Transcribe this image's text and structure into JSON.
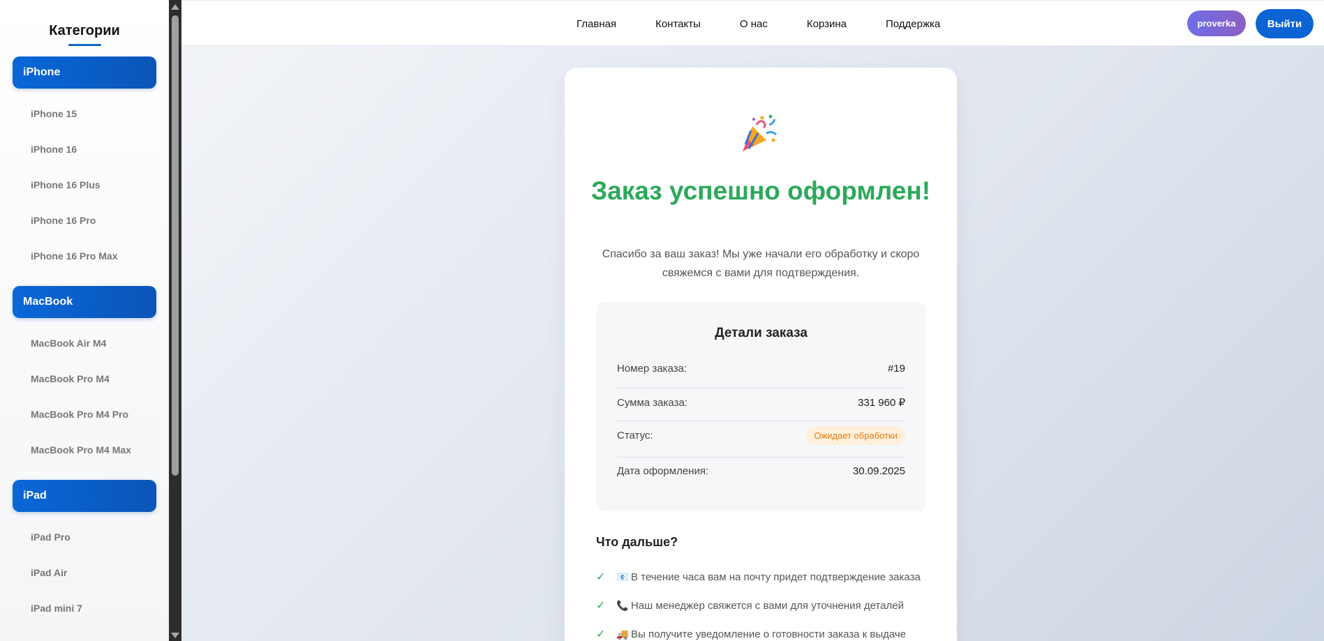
{
  "sidebar": {
    "title": "Категории",
    "categories": [
      {
        "label": "iPhone",
        "items": [
          "iPhone 15",
          "iPhone 16",
          "iPhone 16 Plus",
          "iPhone 16 Pro",
          "iPhone 16 Pro Max"
        ]
      },
      {
        "label": "MacBook",
        "items": [
          "MacBook Air M4",
          "MacBook Pro M4",
          "MacBook Pro M4 Pro",
          "MacBook Pro M4 Max"
        ]
      },
      {
        "label": "iPad",
        "items": [
          "iPad Pro",
          "iPad Air",
          "iPad mini 7"
        ]
      }
    ]
  },
  "nav": {
    "links": [
      "Главная",
      "Контакты",
      "О нас",
      "Корзина",
      "Поддержка"
    ],
    "user": "proverka",
    "logout": "Выйти"
  },
  "order": {
    "title": "Заказ успешно оформлен!",
    "message": "Спасибо за ваш заказ! Мы уже начали его обработку и скоро свяжемся с вами для подтверждения.",
    "details_title": "Детали заказа",
    "number_label": "Номер заказа:",
    "number_value": "#19",
    "sum_label": "Сумма заказа:",
    "sum_value": "331 960 ₽",
    "status_label": "Статус:",
    "status_value": "Ожидает обработки",
    "date_label": "Дата оформления:",
    "date_value": "30.09.2025",
    "status_color": "#e77d10",
    "accent_color": "#2ca95a"
  },
  "next": {
    "title": "Что дальше?",
    "items": [
      {
        "icon": "email-icon",
        "text": "В течение часа вам на почту придет подтверждение заказа"
      },
      {
        "icon": "phone-icon",
        "text": "Наш менеджер свяжется с вами для уточнения деталей"
      },
      {
        "icon": "truck-icon",
        "text": "Вы получите уведомление о готовности заказа к выдаче"
      }
    ]
  }
}
